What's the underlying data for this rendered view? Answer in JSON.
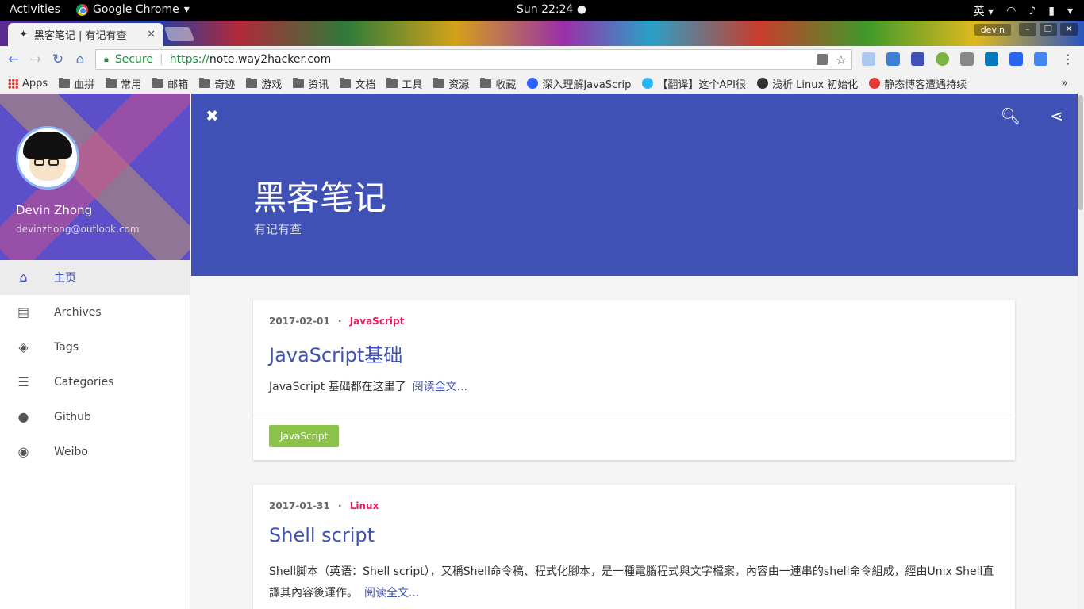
{
  "system": {
    "activities": "Activities",
    "app_name": "Google Chrome",
    "clock": "Sun 22:24",
    "ime": "英"
  },
  "browser": {
    "tab_title": "黑客笔记 | 有记有查",
    "user": "devin",
    "secure_label": "Secure",
    "url_scheme": "https://",
    "url_host": "note.way2hacker.com",
    "bookmarks": [
      {
        "label": "Apps",
        "icon": "apps-grid-icon"
      },
      {
        "label": "血拼",
        "icon": "folder-icon"
      },
      {
        "label": "常用",
        "icon": "folder-icon"
      },
      {
        "label": "邮箱",
        "icon": "folder-icon"
      },
      {
        "label": "奇迹",
        "icon": "folder-icon"
      },
      {
        "label": "游戏",
        "icon": "folder-icon"
      },
      {
        "label": "资讯",
        "icon": "folder-icon"
      },
      {
        "label": "文档",
        "icon": "folder-icon"
      },
      {
        "label": "工具",
        "icon": "folder-icon"
      },
      {
        "label": "资源",
        "icon": "folder-icon"
      },
      {
        "label": "收藏",
        "icon": "folder-icon"
      },
      {
        "label": "深入理解JavaScrip",
        "icon": "site-icon"
      },
      {
        "label": "【翻译】这个API很",
        "icon": "site-icon"
      },
      {
        "label": "浅析 Linux 初始化",
        "icon": "site-icon"
      },
      {
        "label": "静态博客遭遇持续",
        "icon": "site-icon"
      }
    ],
    "bookmarks_more": "»"
  },
  "sidebar": {
    "name": "Devin Zhong",
    "email": "devinzhong@outlook.com",
    "items": [
      {
        "label": "主页",
        "icon": "home-icon",
        "active": true
      },
      {
        "label": "Archives",
        "icon": "archive-icon"
      },
      {
        "label": "Tags",
        "icon": "tags-icon"
      },
      {
        "label": "Categories",
        "icon": "list-icon"
      },
      {
        "label": "Github",
        "icon": "github-icon"
      },
      {
        "label": "Weibo",
        "icon": "weibo-icon"
      }
    ]
  },
  "header": {
    "title": "黑客笔记",
    "subtitle": "有记有查"
  },
  "posts": [
    {
      "date": "2017-02-01",
      "category": "JavaScript",
      "title": "JavaScript基础",
      "excerpt": "JavaScript 基础都在这里了",
      "read_more": "阅读全文...",
      "tag": "JavaScript"
    },
    {
      "date": "2017-01-31",
      "category": "Linux",
      "title": "Shell script",
      "excerpt": "Shell脚本（英语：Shell script），又稱Shell命令稿、程式化腳本，是一種電腦程式與文字檔案，內容由一連串的shell命令組成，經由Unix Shell直譯其內容後運作。",
      "read_more": "阅读全文..."
    }
  ],
  "colors": {
    "primary": "#3f51b5",
    "accent": "#e91e63",
    "tag": "#8bc34a"
  }
}
